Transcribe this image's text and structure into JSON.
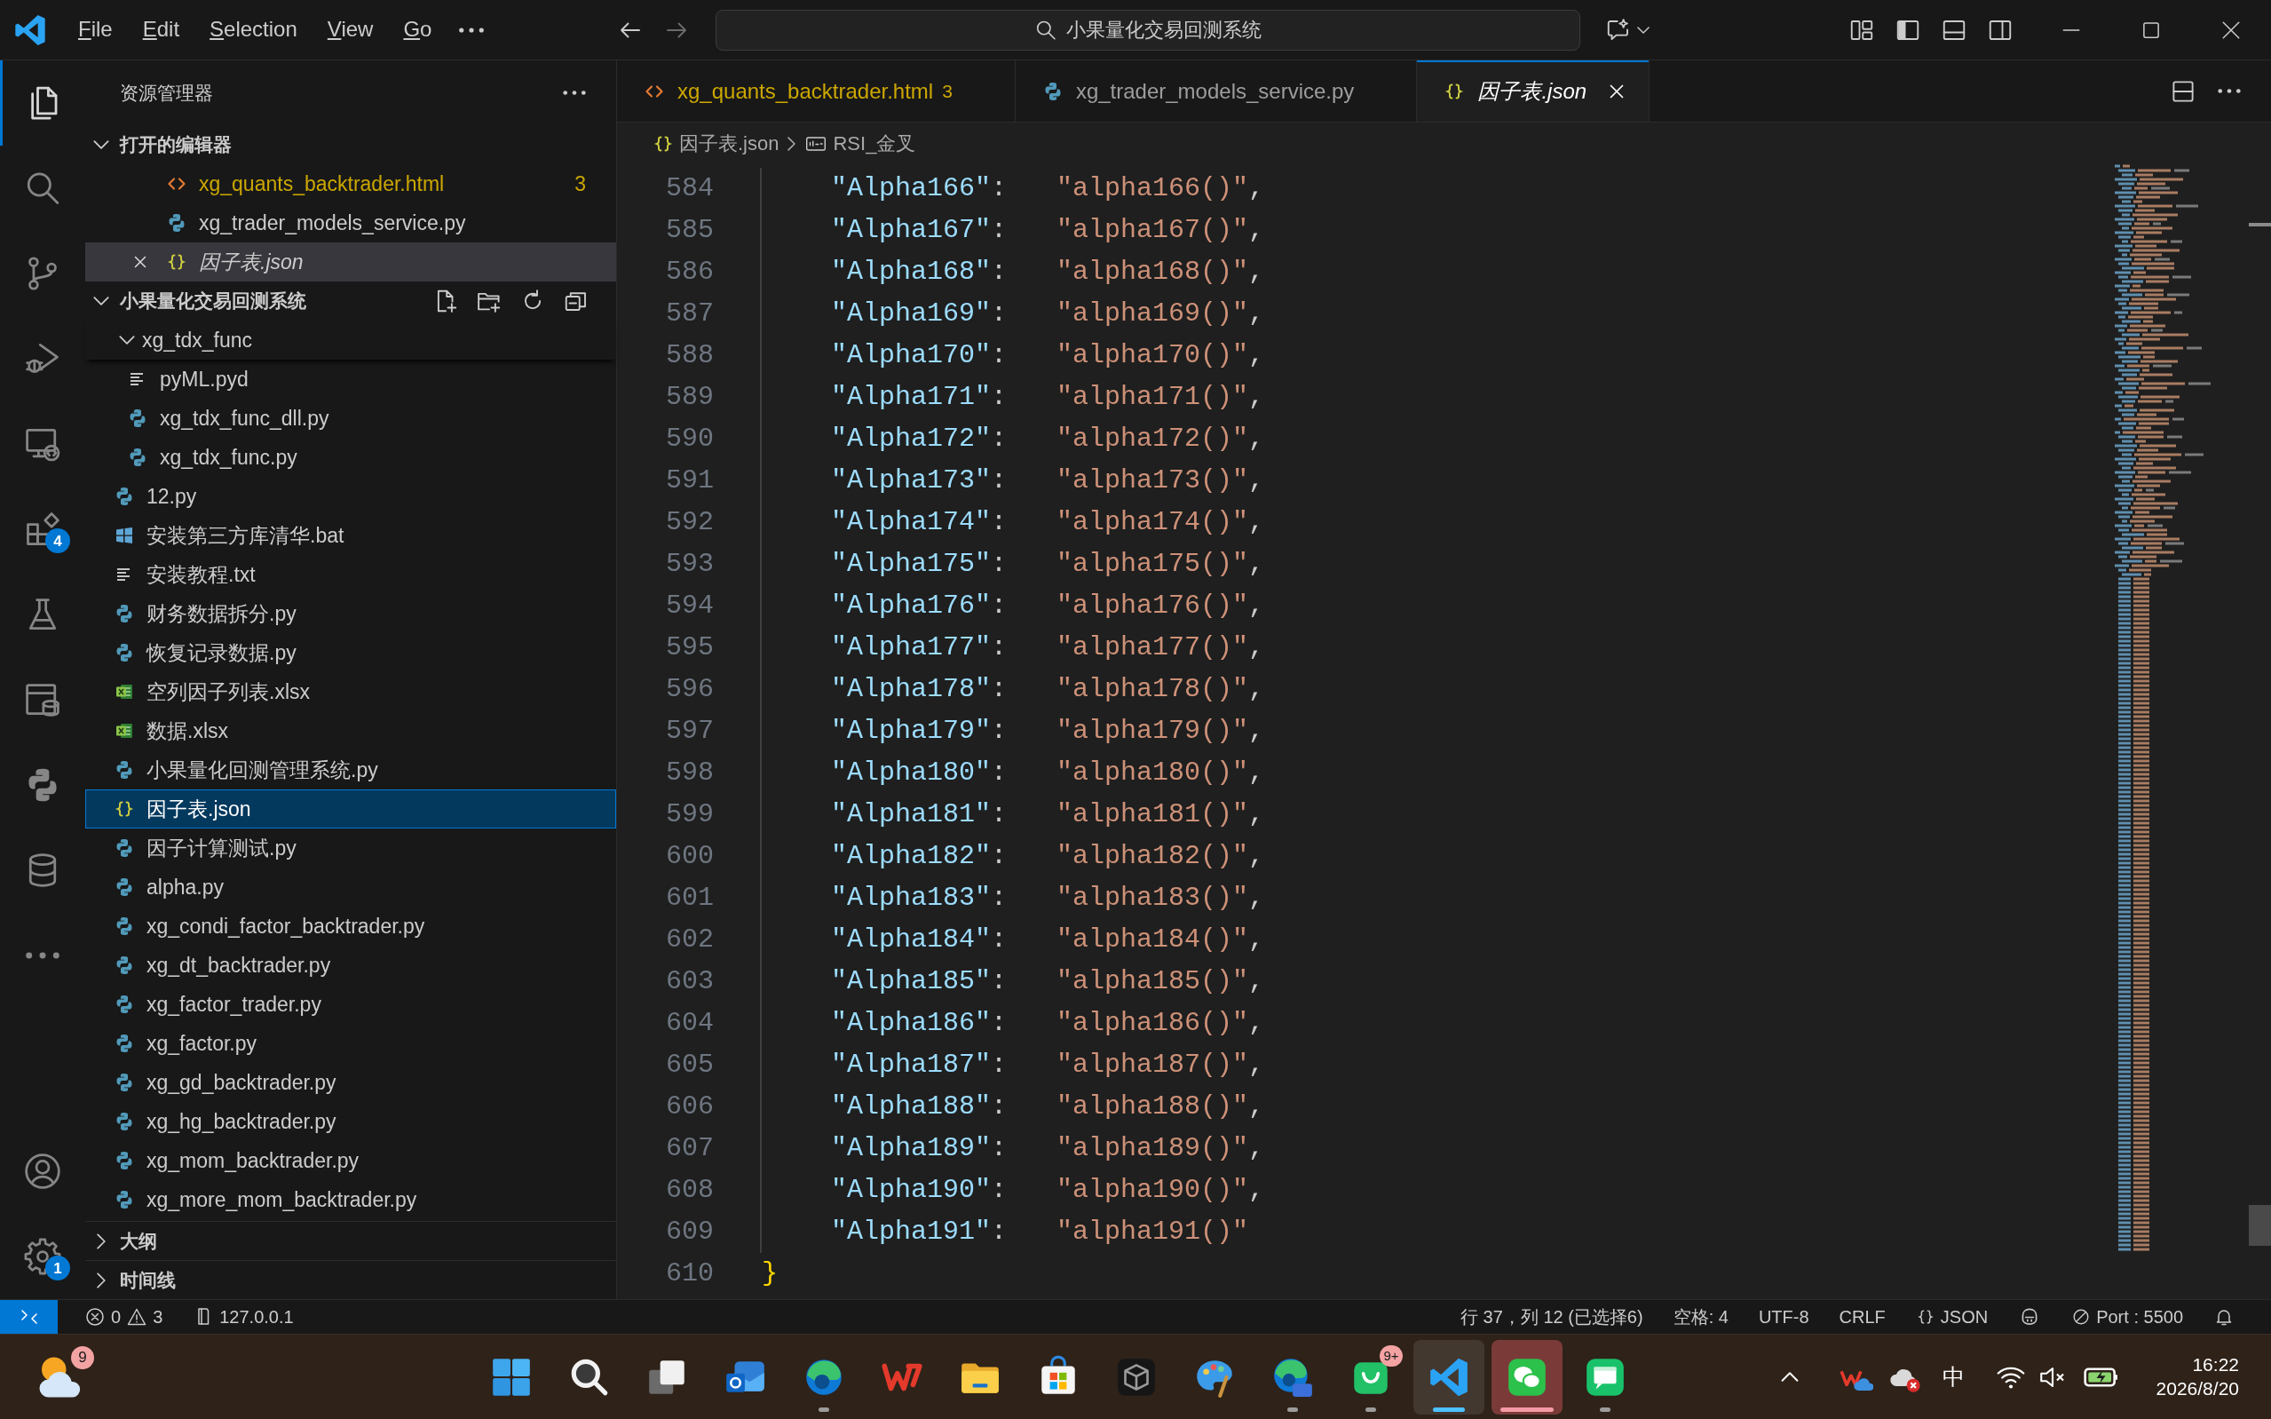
{
  "title_bar": {
    "menus": [
      "File",
      "Edit",
      "Selection",
      "View",
      "Go"
    ],
    "command_center": "小果量化交易回测系统"
  },
  "activity_bar": {
    "top": [
      {
        "kind": "explorer",
        "selected": true
      },
      {
        "kind": "search",
        "selected": false
      },
      {
        "kind": "source_control",
        "selected": false
      },
      {
        "kind": "run_debug",
        "selected": false
      },
      {
        "kind": "remote",
        "selected": false
      },
      {
        "kind": "extensions",
        "selected": false,
        "badge": "4"
      },
      {
        "kind": "testing",
        "selected": false
      },
      {
        "kind": "data",
        "selected": false
      },
      {
        "kind": "python",
        "selected": false
      },
      {
        "kind": "database",
        "selected": false
      },
      {
        "kind": "more",
        "selected": false
      }
    ],
    "bottom": [
      {
        "kind": "account",
        "selected": false
      },
      {
        "kind": "settings",
        "selected": false,
        "badge": "1"
      }
    ]
  },
  "sidebar": {
    "title": "资源管理器",
    "open_editors": {
      "title": "打开的编辑器",
      "expanded": true,
      "items": [
        {
          "label": "xg_quants_backtrader.html",
          "kind": "html",
          "problems": "3",
          "preview": false,
          "selected": false
        },
        {
          "label": "xg_trader_models_service.py",
          "kind": "python",
          "preview": false,
          "selected": false
        },
        {
          "label": "因子表.json",
          "kind": "json",
          "preview": true,
          "selected": true
        }
      ]
    },
    "folder": {
      "title": "小果量化交易回测系统",
      "expanded": true,
      "children": [
        {
          "label": "xg_tdx_func",
          "kind": "folder",
          "expanded": true,
          "selected": false,
          "children": [
            {
              "label": "pyML.pyd",
              "kind": "text",
              "selected": false
            },
            {
              "label": "xg_tdx_func_dll.py",
              "kind": "python",
              "selected": false
            },
            {
              "label": "xg_tdx_func.py",
              "kind": "python",
              "selected": false
            }
          ]
        },
        {
          "label": "12.py",
          "kind": "python",
          "selected": false
        },
        {
          "label": "安装第三方库清华.bat",
          "kind": "batch",
          "selected": false
        },
        {
          "label": "安装教程.txt",
          "kind": "text",
          "selected": false
        },
        {
          "label": "财务数据拆分.py",
          "kind": "python",
          "selected": false
        },
        {
          "label": "恢复记录数据.py",
          "kind": "python",
          "selected": false
        },
        {
          "label": "空列因子列表.xlsx",
          "kind": "excel",
          "selected": false
        },
        {
          "label": "数据.xlsx",
          "kind": "excel",
          "selected": false
        },
        {
          "label": "小果量化回测管理系统.py",
          "kind": "python",
          "selected": false
        },
        {
          "label": "因子表.json",
          "kind": "json",
          "selected": true
        },
        {
          "label": "因子计算测试.py",
          "kind": "python",
          "selected": false
        },
        {
          "label": "alpha.py",
          "kind": "python",
          "selected": false
        },
        {
          "label": "xg_condi_factor_backtrader.py",
          "kind": "python",
          "selected": false
        },
        {
          "label": "xg_dt_backtrader.py",
          "kind": "python",
          "selected": false
        },
        {
          "label": "xg_factor_trader.py",
          "kind": "python",
          "selected": false
        },
        {
          "label": "xg_factor.py",
          "kind": "python",
          "selected": false
        },
        {
          "label": "xg_gd_backtrader.py",
          "kind": "python",
          "selected": false
        },
        {
          "label": "xg_hg_backtrader.py",
          "kind": "python",
          "selected": false
        },
        {
          "label": "xg_mom_backtrader.py",
          "kind": "python",
          "selected": false
        },
        {
          "label": "xg_more_mom_backtrader.py",
          "kind": "python",
          "selected": false
        }
      ]
    },
    "sections": [
      {
        "title": "大纲",
        "expanded": false
      },
      {
        "title": "时间线",
        "expanded": false
      }
    ]
  },
  "tabs": [
    {
      "label": "xg_quants_backtrader.html",
      "kind": "html",
      "problems": "3",
      "preview": false,
      "selected": false
    },
    {
      "label": "xg_trader_models_service.py",
      "kind": "python",
      "preview": false,
      "selected": false
    },
    {
      "label": "因子表.json",
      "kind": "json",
      "preview": true,
      "selected": true
    }
  ],
  "breadcrumbs": [
    {
      "kind": "file",
      "label": "因子表.json"
    },
    {
      "kind": "string",
      "label": "RSI_金叉"
    }
  ],
  "editor": {
    "lines": [
      {
        "number": "584",
        "kind": "entry",
        "key": "\"Alpha166\"",
        "colon": ": ",
        "value": "\"alpha166()\"",
        "end": ","
      },
      {
        "number": "585",
        "kind": "entry",
        "key": "\"Alpha167\"",
        "colon": ": ",
        "value": "\"alpha167()\"",
        "end": ","
      },
      {
        "number": "586",
        "kind": "entry",
        "key": "\"Alpha168\"",
        "colon": ": ",
        "value": "\"alpha168()\"",
        "end": ","
      },
      {
        "number": "587",
        "kind": "entry",
        "key": "\"Alpha169\"",
        "colon": ": ",
        "value": "\"alpha169()\"",
        "end": ","
      },
      {
        "number": "588",
        "kind": "entry",
        "key": "\"Alpha170\"",
        "colon": ": ",
        "value": "\"alpha170()\"",
        "end": ","
      },
      {
        "number": "589",
        "kind": "entry",
        "key": "\"Alpha171\"",
        "colon": ": ",
        "value": "\"alpha171()\"",
        "end": ","
      },
      {
        "number": "590",
        "kind": "entry",
        "key": "\"Alpha172\"",
        "colon": ": ",
        "value": "\"alpha172()\"",
        "end": ","
      },
      {
        "number": "591",
        "kind": "entry",
        "key": "\"Alpha173\"",
        "colon": ": ",
        "value": "\"alpha173()\"",
        "end": ","
      },
      {
        "number": "592",
        "kind": "entry",
        "key": "\"Alpha174\"",
        "colon": ": ",
        "value": "\"alpha174()\"",
        "end": ","
      },
      {
        "number": "593",
        "kind": "entry",
        "key": "\"Alpha175\"",
        "colon": ": ",
        "value": "\"alpha175()\"",
        "end": ","
      },
      {
        "number": "594",
        "kind": "entry",
        "key": "\"Alpha176\"",
        "colon": ": ",
        "value": "\"alpha176()\"",
        "end": ","
      },
      {
        "number": "595",
        "kind": "entry",
        "key": "\"Alpha177\"",
        "colon": ": ",
        "value": "\"alpha177()\"",
        "end": ","
      },
      {
        "number": "596",
        "kind": "entry",
        "key": "\"Alpha178\"",
        "colon": ": ",
        "value": "\"alpha178()\"",
        "end": ","
      },
      {
        "number": "597",
        "kind": "entry",
        "key": "\"Alpha179\"",
        "colon": ": ",
        "value": "\"alpha179()\"",
        "end": ","
      },
      {
        "number": "598",
        "kind": "entry",
        "key": "\"Alpha180\"",
        "colon": ": ",
        "value": "\"alpha180()\"",
        "end": ","
      },
      {
        "number": "599",
        "kind": "entry",
        "key": "\"Alpha181\"",
        "colon": ": ",
        "value": "\"alpha181()\"",
        "end": ","
      },
      {
        "number": "600",
        "kind": "entry",
        "key": "\"Alpha182\"",
        "colon": ": ",
        "value": "\"alpha182()\"",
        "end": ","
      },
      {
        "number": "601",
        "kind": "entry",
        "key": "\"Alpha183\"",
        "colon": ": ",
        "value": "\"alpha183()\"",
        "end": ","
      },
      {
        "number": "602",
        "kind": "entry",
        "key": "\"Alpha184\"",
        "colon": ": ",
        "value": "\"alpha184()\"",
        "end": ","
      },
      {
        "number": "603",
        "kind": "entry",
        "key": "\"Alpha185\"",
        "colon": ": ",
        "value": "\"alpha185()\"",
        "end": ","
      },
      {
        "number": "604",
        "kind": "entry",
        "key": "\"Alpha186\"",
        "colon": ": ",
        "value": "\"alpha186()\"",
        "end": ","
      },
      {
        "number": "605",
        "kind": "entry",
        "key": "\"Alpha187\"",
        "colon": ": ",
        "value": "\"alpha187()\"",
        "end": ","
      },
      {
        "number": "606",
        "kind": "entry",
        "key": "\"Alpha188\"",
        "colon": ": ",
        "value": "\"alpha188()\"",
        "end": ","
      },
      {
        "number": "607",
        "kind": "entry",
        "key": "\"Alpha189\"",
        "colon": ": ",
        "value": "\"alpha189()\"",
        "end": ","
      },
      {
        "number": "608",
        "kind": "entry",
        "key": "\"Alpha190\"",
        "colon": ": ",
        "value": "\"alpha190()\"",
        "end": ","
      },
      {
        "number": "609",
        "kind": "entry",
        "key": "\"Alpha191\"",
        "colon": ": ",
        "value": "\"alpha191()\""
      },
      {
        "number": "610",
        "kind": "bracket",
        "text": "}"
      }
    ]
  },
  "status_bar": {
    "errors": "0",
    "warnings": "3",
    "host": "127.0.0.1",
    "cursor": "行 37，列 12 (已选择6)",
    "indentation": "空格: 4",
    "encoding": "UTF-8",
    "line_endings": "CRLF",
    "language": "JSON",
    "port": "Port : 5500"
  },
  "taskbar": {
    "widgets": {
      "kind": "weather",
      "badge": "9"
    },
    "apps": [
      {
        "kind": "start",
        "running": false,
        "focused": false,
        "flashing": false
      },
      {
        "kind": "search",
        "running": false,
        "focused": false,
        "flashing": false
      },
      {
        "kind": "task_view",
        "running": false,
        "focused": false,
        "flashing": false
      },
      {
        "kind": "mail",
        "running": false,
        "focused": false,
        "flashing": false
      },
      {
        "kind": "browser",
        "running": true,
        "focused": false,
        "flashing": false
      },
      {
        "kind": "office",
        "running": false,
        "focused": false,
        "flashing": false
      },
      {
        "kind": "files",
        "running": false,
        "focused": false,
        "flashing": false
      },
      {
        "kind": "store",
        "running": false,
        "focused": false,
        "flashing": false
      },
      {
        "kind": "cube",
        "running": false,
        "focused": false,
        "flashing": false
      },
      {
        "kind": "paint",
        "running": false,
        "focused": false,
        "flashing": false
      },
      {
        "kind": "browser_ai",
        "running": true,
        "focused": false,
        "flashing": false
      },
      {
        "kind": "shopping",
        "running": true,
        "focused": false,
        "flashing": false,
        "badge": "9+"
      },
      {
        "kind": "editor",
        "running": true,
        "focused": true,
        "flashing": false
      },
      {
        "kind": "chat",
        "running": true,
        "focused": false,
        "flashing": true
      },
      {
        "kind": "messages",
        "running": true,
        "focused": false,
        "flashing": false
      }
    ],
    "tray": {
      "ime": "中"
    },
    "clock": {
      "time": "16:22",
      "date": "2026/8/20"
    }
  }
}
